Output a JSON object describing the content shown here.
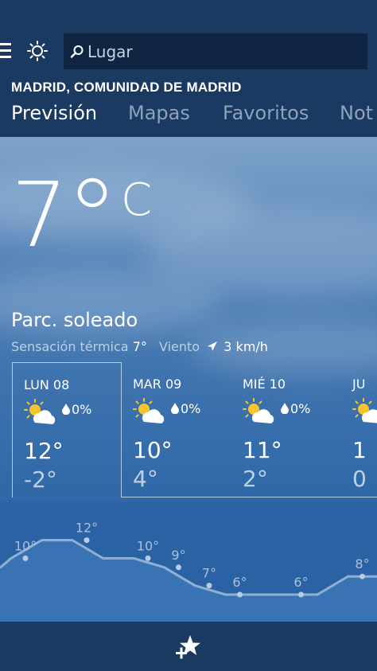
{
  "search": {
    "placeholder": "Lugar"
  },
  "location": "MADRID, COMUNIDAD DE MADRID",
  "tabs": [
    {
      "label": "Previsión",
      "active": true
    },
    {
      "label": "Mapas",
      "active": false
    },
    {
      "label": "Favoritos",
      "active": false
    },
    {
      "label": "Not",
      "active": false
    }
  ],
  "current": {
    "temp": "7",
    "unit": "C",
    "condition": "Parc. soleado",
    "feels_label": "Sensación térmica",
    "feels_value": "7°",
    "wind_label": "Viento",
    "wind_value": "3 km/h"
  },
  "days": [
    {
      "name": "LUN 08",
      "precip": "0%",
      "high": "12°",
      "low": "-2°",
      "icon": "partly-sunny-icon"
    },
    {
      "name": "MAR 09",
      "precip": "0%",
      "high": "10°",
      "low": "4°",
      "icon": "partly-sunny-icon"
    },
    {
      "name": "MIÉ 10",
      "precip": "0%",
      "high": "11°",
      "low": "2°",
      "icon": "partly-sunny-icon"
    },
    {
      "name": "JU",
      "precip": "",
      "high": "1",
      "low": "0",
      "icon": "partly-sunny-icon"
    }
  ],
  "hourly": {
    "values": [
      10,
      12,
      12,
      10,
      10,
      9,
      7,
      6,
      6,
      6,
      6,
      8,
      8
    ],
    "labels": [
      "10°",
      "12°",
      "10°",
      "9°",
      "7°",
      "6°",
      "6°",
      "8°"
    ],
    "label_indices": [
      0,
      2,
      4,
      5,
      6,
      7,
      9,
      11
    ]
  },
  "colors": {
    "header": "#1b3a61",
    "graph_bg": "#2a62a4",
    "graph_fill": "#3a73b4",
    "graph_line": "#8fb0d4"
  }
}
